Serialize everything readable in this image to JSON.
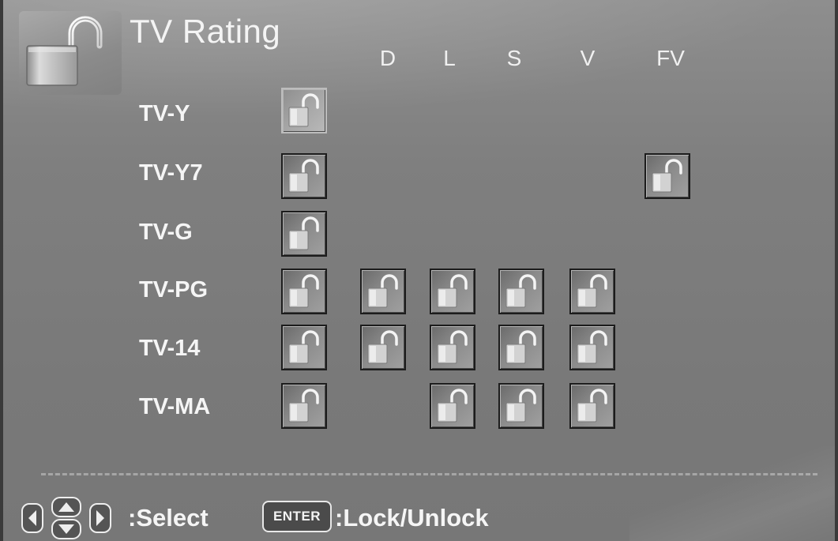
{
  "screen": {
    "title": "TV Rating",
    "title_icon": "unlocked-padlock-icon"
  },
  "columns": [
    "D",
    "L",
    "S",
    "V",
    "FV"
  ],
  "rows": [
    {
      "label": "TV-Y",
      "rating": "unlocked",
      "D": null,
      "L": null,
      "S": null,
      "V": null,
      "FV": null
    },
    {
      "label": "TV-Y7",
      "rating": "unlocked",
      "D": null,
      "L": null,
      "S": null,
      "V": null,
      "FV": "unlocked"
    },
    {
      "label": "TV-G",
      "rating": "unlocked",
      "D": null,
      "L": null,
      "S": null,
      "V": null,
      "FV": null
    },
    {
      "label": "TV-PG",
      "rating": "unlocked",
      "D": "unlocked",
      "L": "unlocked",
      "S": "unlocked",
      "V": "unlocked",
      "FV": null
    },
    {
      "label": "TV-14",
      "rating": "unlocked",
      "D": "unlocked",
      "L": "unlocked",
      "S": "unlocked",
      "V": "unlocked",
      "FV": null
    },
    {
      "label": "TV-MA",
      "rating": "unlocked",
      "D": null,
      "L": "unlocked",
      "S": "unlocked",
      "V": "unlocked",
      "FV": null
    }
  ],
  "focused_cell": {
    "row": "TV-Y",
    "column": "rating"
  },
  "footer": {
    "nav_icon": "arrow-keys-icon",
    "select_label": ":Select",
    "enter_key_label": "ENTER",
    "lock_label": ":Lock/Unlock"
  }
}
